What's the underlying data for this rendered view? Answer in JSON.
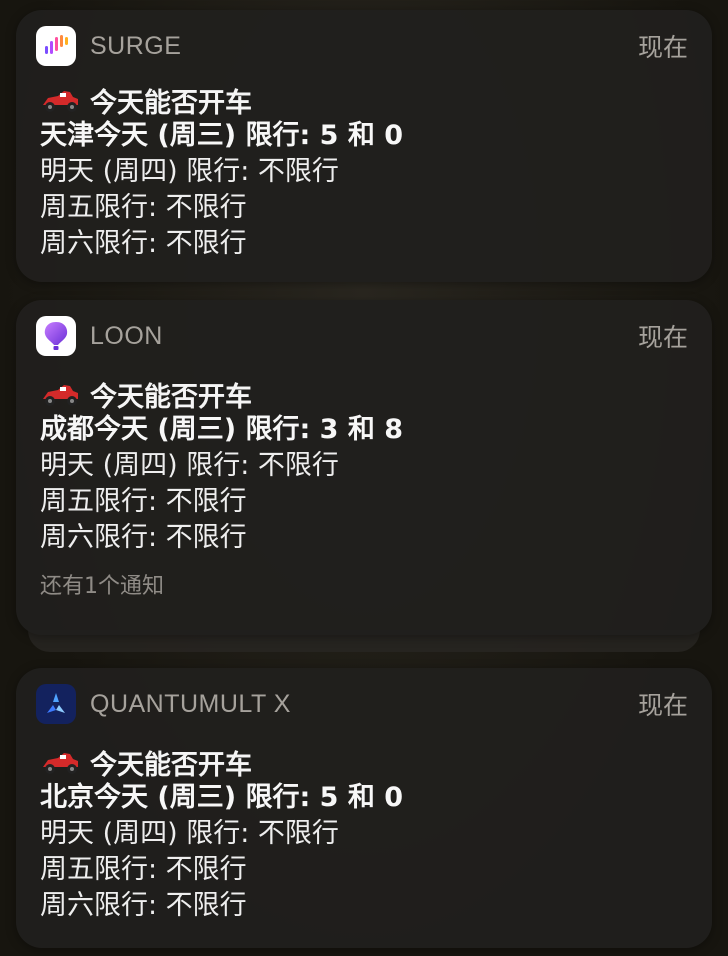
{
  "notifications": [
    {
      "app": "SURGE",
      "time": "现在",
      "title": "今天能否开车",
      "lines": [
        "天津今天 (周三) 限行: 5 和 0",
        "明天 (周四) 限行: 不限行",
        "周五限行: 不限行",
        "周六限行: 不限行"
      ],
      "icon": "surge-app-icon"
    },
    {
      "app": "LOON",
      "time": "现在",
      "title": "今天能否开车",
      "lines": [
        "成都今天 (周三) 限行: 3 和 8",
        "明天 (周四) 限行: 不限行",
        "周五限行: 不限行",
        "周六限行: 不限行"
      ],
      "more": "还有1个通知",
      "icon": "loon-app-icon"
    },
    {
      "app": "QUANTUMULT X",
      "time": "现在",
      "title": "今天能否开车",
      "lines": [
        "北京今天 (周三) 限行: 5 和 0",
        "明天 (周四) 限行: 不限行",
        "周五限行: 不限行",
        "周六限行: 不限行"
      ],
      "icon": "quantumult-x-app-icon"
    }
  ],
  "colors": {
    "card_bg": "#201f1d",
    "secondary_text": "#a6a29c",
    "primary_text": "#f5f5f5",
    "surge_icon_bg": "#ffffff",
    "loon_icon_bg": "#ffffff",
    "quantumult_icon_bg": "#1a2a6b"
  }
}
